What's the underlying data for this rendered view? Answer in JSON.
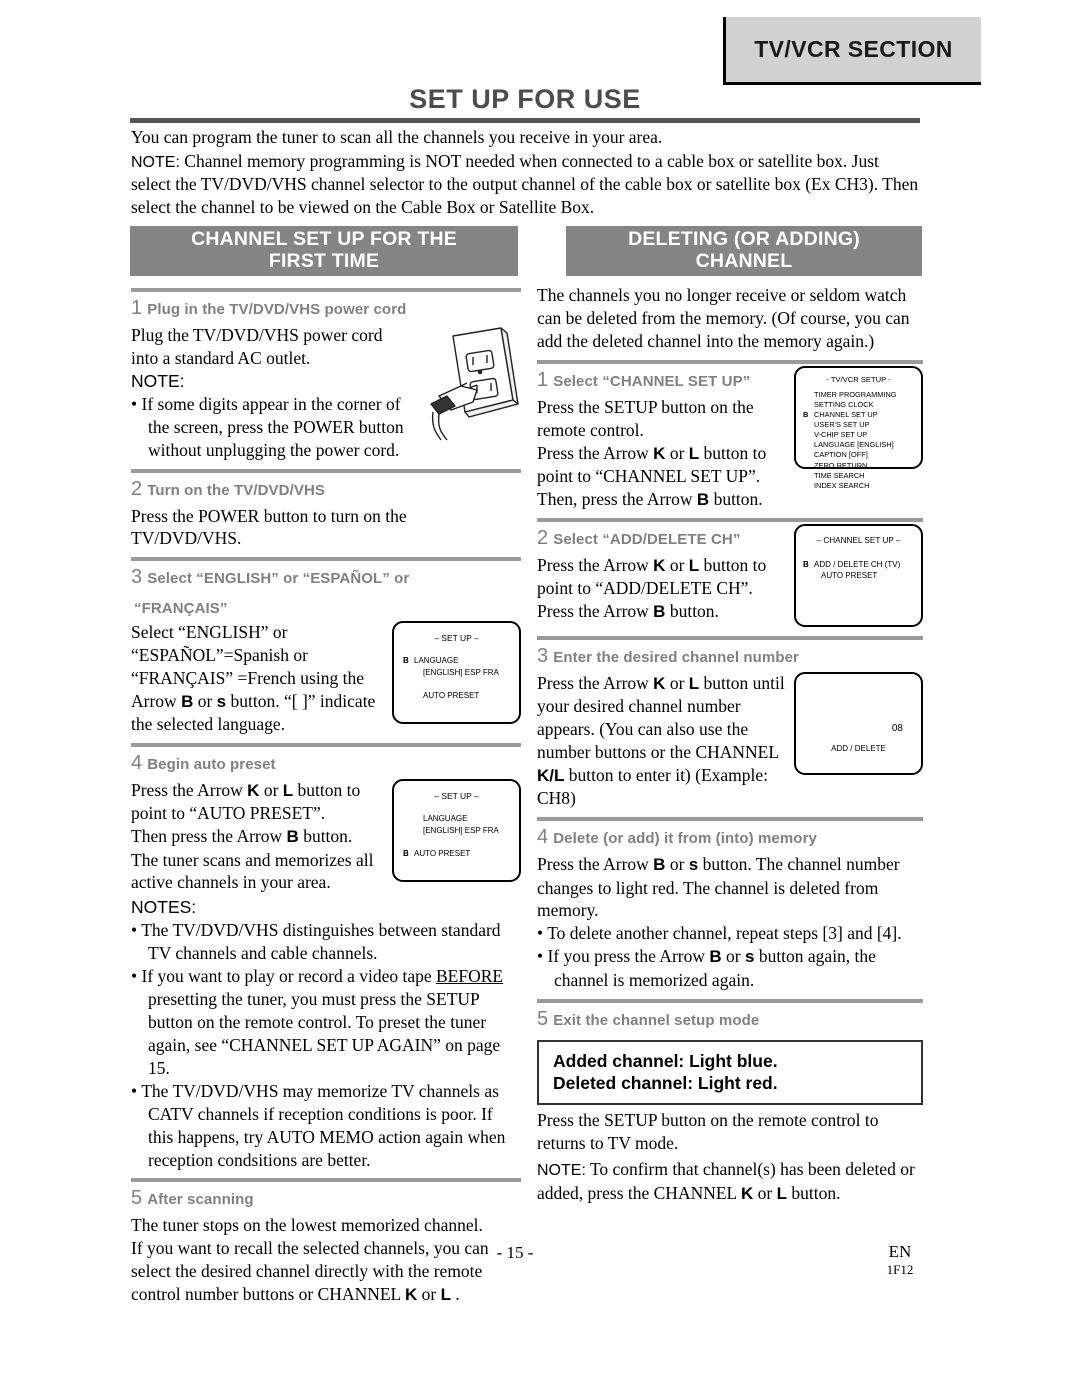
{
  "header": {
    "section_tab": "TV/VCR SECTION",
    "page_title": "SET UP FOR USE"
  },
  "intro": {
    "line1": "You can program the tuner to scan all the channels you receive in your area.",
    "note_label": "NOTE:",
    "note_text": " Channel memory programming is NOT needed when connected to a cable box or satellite box. Just select the TV/DVD/VHS channel selector to the output channel of the cable box or satellite box (Ex CH3). Then select the channel to be viewed on the Cable Box or Satellite Box."
  },
  "left_column": {
    "band_title_line1": "CHANNEL SET UP FOR THE",
    "band_title_line2": "FIRST TIME",
    "step1": {
      "num": "1",
      "title": "Plug in the TV/DVD/VHS power cord",
      "body1": "Plug the TV/DVD/VHS power cord into a standard AC outlet.",
      "note_label": "NOTE:",
      "bullet1": "If some digits appear in the corner of the screen, press the POWER button without unplugging the power cord."
    },
    "step2": {
      "num": "2",
      "title": "Turn on the TV/DVD/VHS",
      "body1": "Press the POWER button to turn on the TV/DVD/VHS."
    },
    "step3": {
      "num": "3",
      "title_line1": "Select “ENGLISH” or “ESPAÑOL” or",
      "title_line2": "“FRANÇAIS”",
      "body_a": "Select “ENGLISH” or “ESPAÑOL”=Spanish or “FRANÇAIS” =French using the Arrow ",
      "arrow_b": "B",
      "body_b": " or ",
      "arrow_s": "s",
      "body_c": " button. “[ ]” indicate the selected language."
    },
    "step4": {
      "num": "4",
      "title": "Begin auto preset",
      "body_a": "Press the Arrow ",
      "arrow_k": "K",
      "body_b": " or ",
      "arrow_l": "L",
      "body_c": " button to point to “AUTO PRESET”.",
      "body2_a": "Then press the Arrow ",
      "arrow_b": "B",
      "body2_b": " button.",
      "body3": "The tuner scans and memorizes all active channels in your area."
    },
    "notes": {
      "label": "NOTES:",
      "bullet1": "The TV/DVD/VHS distinguishes between standard TV channels and cable channels.",
      "bullet2_a": "If you want to play or record a video tape ",
      "bullet2_u": "BEFORE",
      "bullet2_b": " presetting the tuner, you must press the SETUP button on the remote control. To preset the tuner again, see “CHANNEL SET UP AGAIN” on page 15.",
      "bullet3": "The TV/DVD/VHS may memorize TV channels as CATV channels if reception conditions is poor. If this happens, try AUTO MEMO action again when reception condsitions are better."
    },
    "step5": {
      "num": "5",
      "title": "After scanning",
      "body1": "The tuner stops on the lowest memorized channel.",
      "body2_a": "If you want to recall the selected channels, you can select the desired channel directly with the remote control number buttons or CHANNEL ",
      "arrow_k": "K",
      "body2_b": " or ",
      "arrow_l": "L",
      "body2_c": " ."
    }
  },
  "right_column": {
    "band_title_line1": "DELETING (OR ADDING)",
    "band_title_line2": "CHANNEL",
    "intro": "The channels you no longer receive or seldom watch can be deleted from the memory. (Of course, you can add the deleted channel into the memory again.)",
    "step1": {
      "num": "1",
      "title": "Select “CHANNEL SET UP”",
      "body1": "Press the SETUP button on the remote control.",
      "body2_a": "Press the Arrow ",
      "arrow_k": "K",
      "body2_b": " or ",
      "arrow_l": "L",
      "body2_c": " button to point to “CHANNEL SET UP”.",
      "body3_a": "Then, press the Arrow ",
      "arrow_b": "B",
      "body3_b": " button."
    },
    "step2": {
      "num": "2",
      "title": "Select “ADD/DELETE CH”",
      "body1_a": "Press the Arrow ",
      "arrow_k": "K",
      "body1_b": " or ",
      "arrow_l": "L",
      "body1_c": " button to point to “ADD/DELETE CH”.",
      "body2_a": "Press the Arrow ",
      "arrow_b": "B",
      "body2_b": " button."
    },
    "step3": {
      "num": "3",
      "title": "Enter the desired channel number",
      "body_a": "Press the Arrow ",
      "arrow_k": "K",
      "body_b": " or ",
      "arrow_l": "L",
      "body_c": " button until your desired channel number appears. (You can also use the number buttons  or the CHANNEL ",
      "arrow_kl": "K/L",
      "body_d": " button to enter it) (Example: CH8)"
    },
    "step4": {
      "num": "4",
      "title": "Delete (or add) it from (into) memory",
      "body_a": "Press the Arrow ",
      "arrow_b": "B",
      "body_b": " or ",
      "arrow_s": "s",
      "body_c": " button. The channel number changes to light red. The channel is deleted from memory.",
      "bullet1": "To delete another channel, repeat steps [3] and [4].",
      "bullet2_a": "If you press the Arrow ",
      "bullet2_arrow_b": "B",
      "bullet2_b": " or ",
      "bullet2_arrow_s": "s",
      "bullet2_c": " button again, the channel is memorized again."
    },
    "step5": {
      "num": "5",
      "title": "Exit the channel setup mode",
      "box_line1": "Added channel: Light blue.",
      "box_line2": "Deleted channel: Light red.",
      "body1": "Press the SETUP button on the remote control to returns to TV mode.",
      "note_label": "NOTE:",
      "note_a": " To confirm that channel(s) has been deleted or added, press the CHANNEL ",
      "arrow_k": "K",
      "note_b": " or ",
      "arrow_l": "L",
      "note_c": " button."
    }
  },
  "osd": {
    "setup_lang": {
      "title": "– SET UP –",
      "cursor": "B",
      "item_language": "LANGUAGE",
      "item_language_values": "[ENGLISH]  ESP      FRA",
      "item_auto_preset": "AUTO PRESET"
    },
    "setup_auto": {
      "title": "– SET UP –",
      "cursor": "B",
      "item_language": "LANGUAGE",
      "item_language_values": "[ENGLISH]  ESP      FRA",
      "item_auto_preset": "AUTO PRESET"
    },
    "tvvcr_setup": {
      "title": "- TV/VCR SETUP -",
      "cursor": "B",
      "items": [
        "TIMER PROGRAMMING",
        "SETTING CLOCK",
        "CHANNEL SET UP",
        "USER'S SET UP",
        "V-CHIP SET UP",
        "LANGUAGE  [ENGLISH]",
        "CAPTION  [OFF]",
        "ZERO RETURN",
        "TIME SEARCH",
        "INDEX SEARCH"
      ]
    },
    "channel_setup": {
      "title": "– CHANNEL SET UP –",
      "cursor": "B",
      "item1": "ADD / DELETE CH (TV)",
      "item2": "AUTO PRESET"
    },
    "add_delete": {
      "channel_number": "08",
      "label": "ADD / DELETE"
    }
  },
  "footer": {
    "page_number": "- 15 -",
    "lang_code": "EN",
    "doc_code": "1F12"
  },
  "colors": {
    "band_gray": "#858585",
    "tab_gray": "#d2d2d2",
    "step_gray": "#808080",
    "title_gray": "#4d4d4d"
  }
}
